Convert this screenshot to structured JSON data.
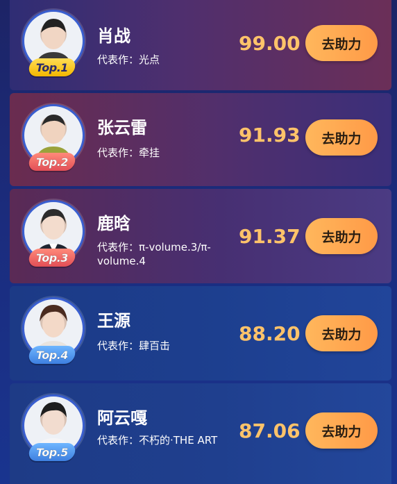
{
  "ranking": [
    {
      "rank": 1,
      "badge": "Top.1",
      "name": "肖战",
      "work": "代表作：光点",
      "score": "99.00",
      "button": "去助力",
      "badge_color": "#ffcf2e"
    },
    {
      "rank": 2,
      "badge": "Top.2",
      "name": "张云雷",
      "work": "代表作：牵挂",
      "score": "91.93",
      "button": "去助力",
      "badge_color": "#f0656b"
    },
    {
      "rank": 3,
      "badge": "Top.3",
      "name": "鹿晗",
      "work": "代表作：π-volume.3/π-volume.4",
      "score": "91.37",
      "button": "去助力",
      "badge_color": "#f0656b"
    },
    {
      "rank": 4,
      "badge": "Top.4",
      "name": "王源",
      "work": "代表作：肆百击",
      "score": "88.20",
      "button": "去助力",
      "badge_color": "#5aa2f5"
    },
    {
      "rank": 5,
      "badge": "Top.5",
      "name": "阿云嘎",
      "work": "代表作：不朽的·THE ART",
      "score": "87.06",
      "button": "去助力",
      "badge_color": "#5aa2f5"
    }
  ],
  "colors": {
    "score": "#ffc36a",
    "button": "#ffa64f",
    "text": "#ffffff"
  }
}
